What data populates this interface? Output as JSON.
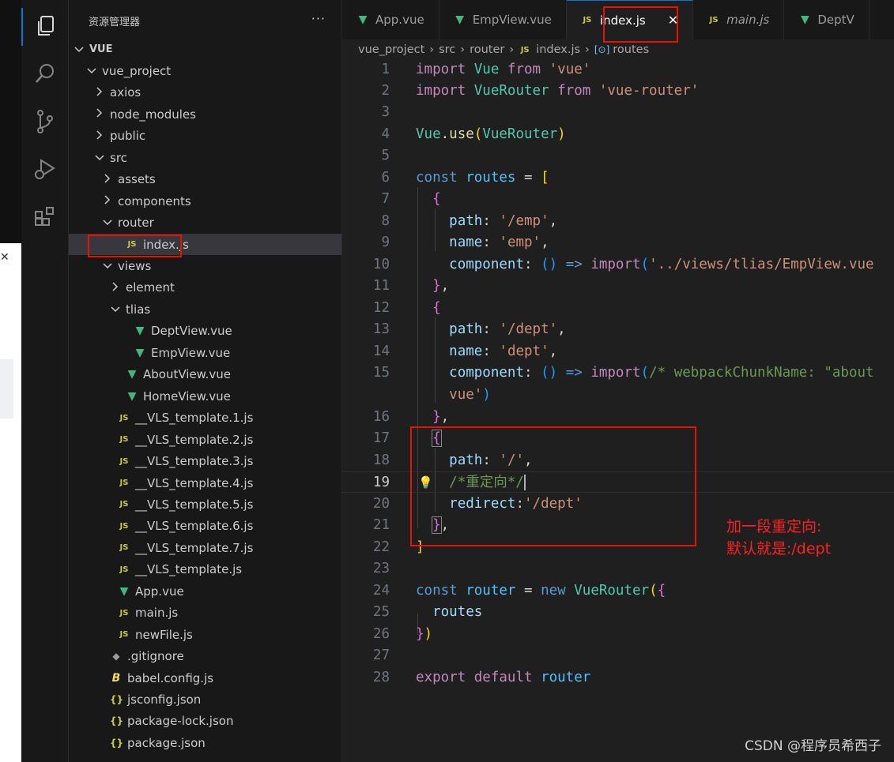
{
  "sidebar": {
    "title": "资源管理器",
    "more": "···",
    "tree": [
      {
        "label": "VUE",
        "chev": "v",
        "icon": "",
        "indent": 0,
        "bold": true
      },
      {
        "label": "vue_project",
        "chev": "v",
        "icon": "",
        "indent": 1
      },
      {
        "label": "axios",
        "chev": ">",
        "icon": "",
        "indent": 2
      },
      {
        "label": "node_modules",
        "chev": ">",
        "icon": "",
        "indent": 2
      },
      {
        "label": "public",
        "chev": ">",
        "icon": "",
        "indent": 2
      },
      {
        "label": "src",
        "chev": "v",
        "icon": "",
        "indent": 2
      },
      {
        "label": "assets",
        "chev": ">",
        "icon": "",
        "indent": 3
      },
      {
        "label": "components",
        "chev": ">",
        "icon": "",
        "indent": 3
      },
      {
        "label": "router",
        "chev": "v",
        "icon": "",
        "indent": 3
      },
      {
        "label": "index.js",
        "chev": "",
        "icon": "js",
        "indent": 4,
        "selected": true
      },
      {
        "label": "views",
        "chev": "v",
        "icon": "",
        "indent": 3
      },
      {
        "label": "element",
        "chev": ">",
        "icon": "",
        "indent": 4
      },
      {
        "label": "tlias",
        "chev": "v",
        "icon": "",
        "indent": 4
      },
      {
        "label": "DeptView.vue",
        "chev": "",
        "icon": "vue",
        "indent": 5
      },
      {
        "label": "EmpView.vue",
        "chev": "",
        "icon": "vue",
        "indent": 5
      },
      {
        "label": "AboutView.vue",
        "chev": "",
        "icon": "vue",
        "indent": 4
      },
      {
        "label": "HomeView.vue",
        "chev": "",
        "icon": "vue",
        "indent": 4
      },
      {
        "label": "__VLS_template.1.js",
        "chev": "",
        "icon": "js",
        "indent": 3
      },
      {
        "label": "__VLS_template.2.js",
        "chev": "",
        "icon": "js",
        "indent": 3
      },
      {
        "label": "__VLS_template.3.js",
        "chev": "",
        "icon": "js",
        "indent": 3
      },
      {
        "label": "__VLS_template.4.js",
        "chev": "",
        "icon": "js",
        "indent": 3
      },
      {
        "label": "__VLS_template.5.js",
        "chev": "",
        "icon": "js",
        "indent": 3
      },
      {
        "label": "__VLS_template.6.js",
        "chev": "",
        "icon": "js",
        "indent": 3
      },
      {
        "label": "__VLS_template.7.js",
        "chev": "",
        "icon": "js",
        "indent": 3
      },
      {
        "label": "__VLS_template.js",
        "chev": "",
        "icon": "js",
        "indent": 3
      },
      {
        "label": "App.vue",
        "chev": "",
        "icon": "vue",
        "indent": 3
      },
      {
        "label": "main.js",
        "chev": "",
        "icon": "js",
        "indent": 3
      },
      {
        "label": "newFile.js",
        "chev": "",
        "icon": "js",
        "indent": 3
      },
      {
        "label": ".gitignore",
        "chev": "",
        "icon": "git",
        "indent": 2
      },
      {
        "label": "babel.config.js",
        "chev": "",
        "icon": "babel",
        "indent": 2
      },
      {
        "label": "jsconfig.json",
        "chev": "",
        "icon": "json",
        "indent": 2
      },
      {
        "label": "package-lock.json",
        "chev": "",
        "icon": "json",
        "indent": 2
      },
      {
        "label": "package.json",
        "chev": "",
        "icon": "json",
        "indent": 2
      }
    ]
  },
  "tabs": [
    {
      "label": "App.vue",
      "icon": "vue"
    },
    {
      "label": "EmpView.vue",
      "icon": "vue"
    },
    {
      "label": "index.js",
      "icon": "js",
      "active": true,
      "close": "✕"
    },
    {
      "label": "main.js",
      "icon": "js",
      "italic": true
    },
    {
      "label": "DeptV",
      "icon": "vue"
    }
  ],
  "breadcrumb": [
    "vue_project",
    "src",
    "router",
    "index.js",
    "routes"
  ],
  "code_lines": [
    "1",
    "2",
    "3",
    "4",
    "5",
    "6",
    "7",
    "8",
    "9",
    "10",
    "11",
    "12",
    "13",
    "14",
    "15",
    "",
    "16",
    "17",
    "18",
    "19",
    "20",
    "21",
    "22",
    "23",
    "24",
    "25",
    "26",
    "27",
    "28"
  ],
  "current_line": "19",
  "annotation": {
    "line1": "加一段重定向:",
    "line2": "默认就是:/dept"
  },
  "watermark": "CSDN @程序员希西子",
  "icon_labels": {
    "js": "JS"
  }
}
